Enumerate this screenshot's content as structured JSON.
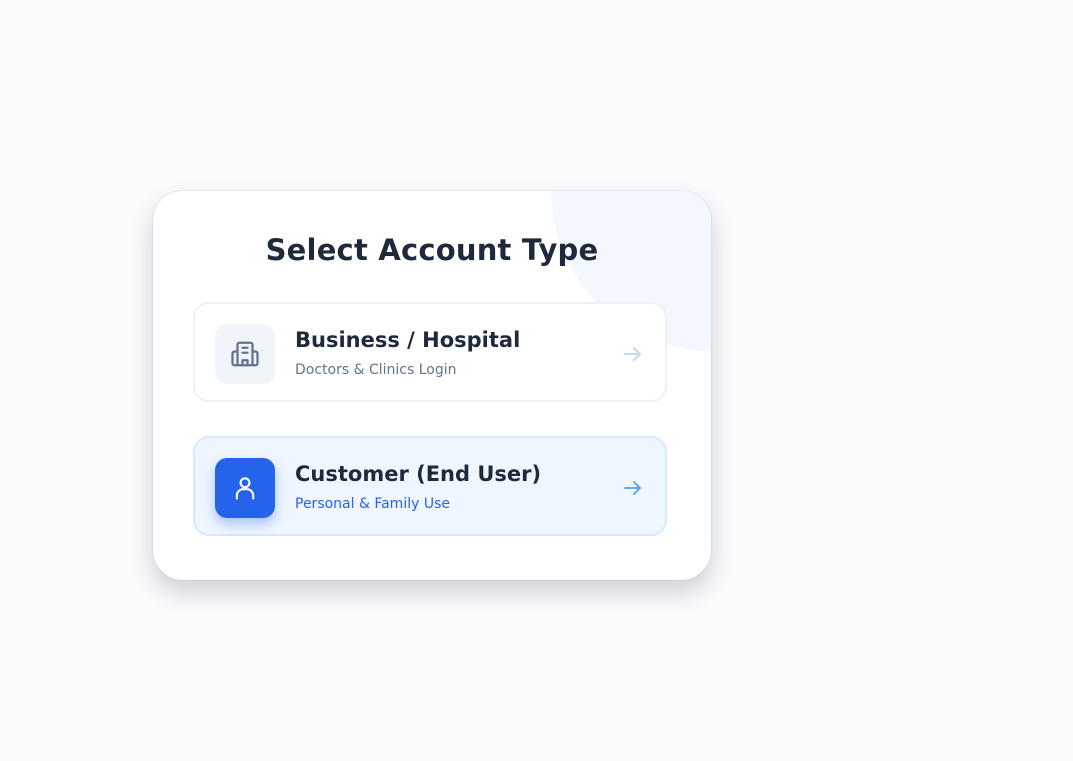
{
  "title": "Select Account Type",
  "options": [
    {
      "title": "Business / Hospital",
      "subtitle": "Doctors & Clinics Login",
      "icon": "building-icon",
      "selected": false
    },
    {
      "title": "Customer (End User)",
      "subtitle": "Personal & Family Use",
      "icon": "user-icon",
      "selected": true
    }
  ],
  "colors": {
    "accent": "#2563eb",
    "selected_bg": "#eff6ff",
    "heading": "#1e293b",
    "muted": "#64748b"
  }
}
